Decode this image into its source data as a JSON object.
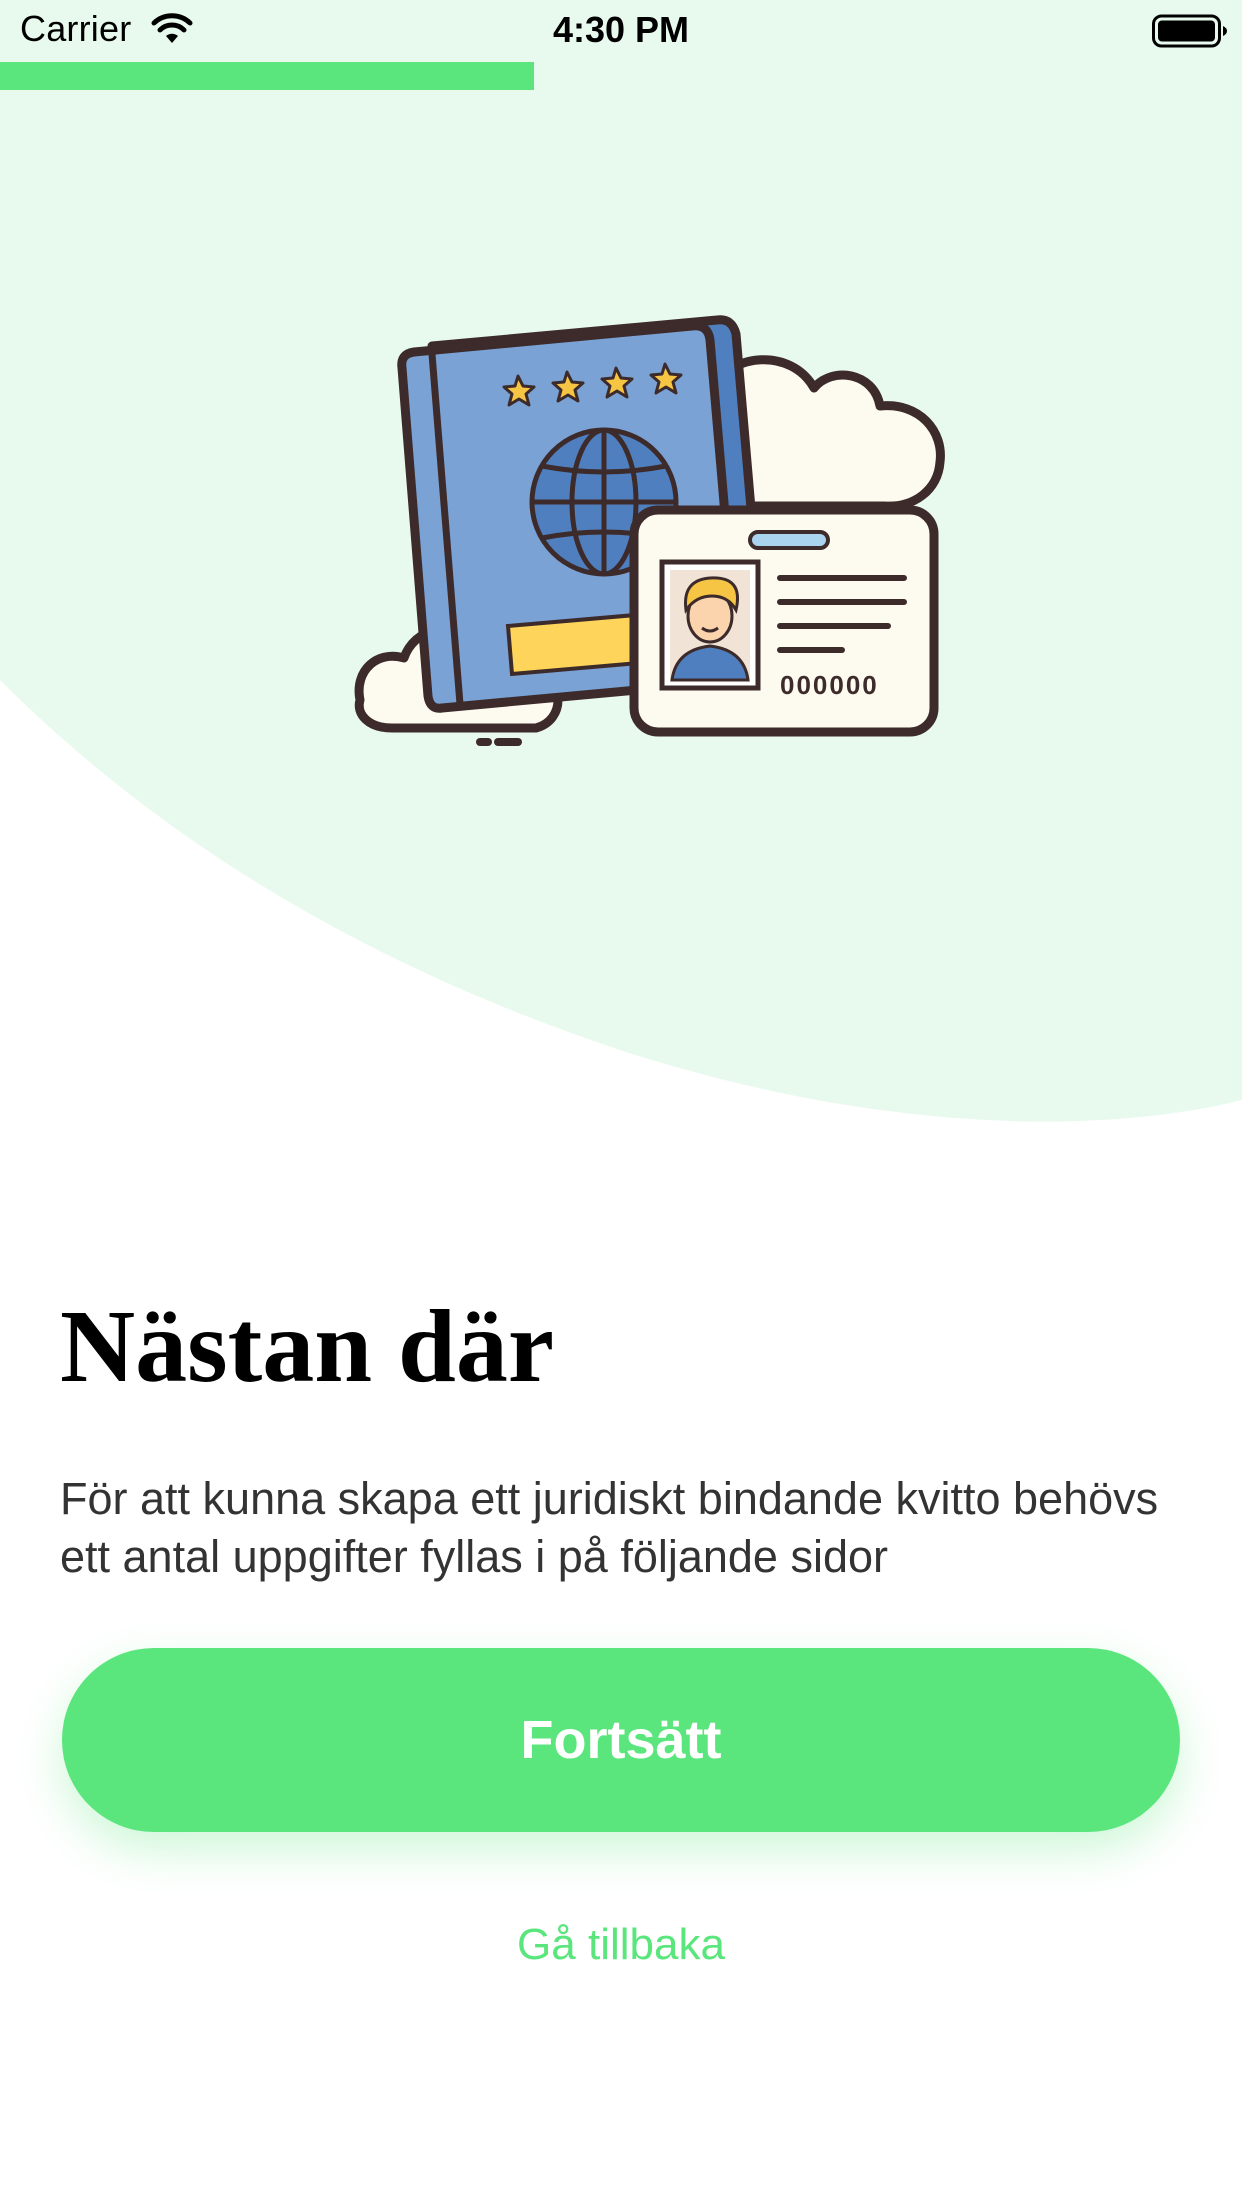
{
  "status_bar": {
    "carrier": "Carrier",
    "time": "4:30 PM",
    "wifi_icon": "wifi-icon",
    "battery_icon": "battery-full-icon"
  },
  "progress": {
    "fraction": 0.43,
    "color": "#5ae67c"
  },
  "illustration": {
    "name": "passport-and-id-card-illustration",
    "card_number": "000000"
  },
  "content": {
    "title": "Nästan där",
    "description": "För att kunna skapa ett juridiskt bindande kvitto behövs ett antal uppgifter fyllas i på följande sidor"
  },
  "actions": {
    "continue_label": "Fortsätt",
    "back_label": "Gå tillbaka"
  },
  "colors": {
    "accent": "#5ae67c",
    "background_tint": "#e8faed",
    "text_primary": "#000000",
    "text_secondary": "#333333"
  }
}
